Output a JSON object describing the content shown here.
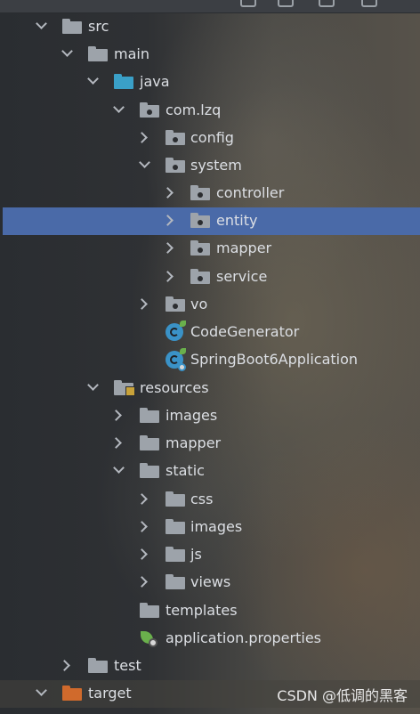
{
  "tree": {
    "items": [
      {
        "label": "src",
        "expanded": true,
        "icon": "folder-icon"
      },
      {
        "label": "main",
        "expanded": true,
        "icon": "folder-icon"
      },
      {
        "label": "java",
        "expanded": true,
        "icon": "source-folder-icon",
        "color": "#3aa0c8"
      },
      {
        "label": "com.lzq",
        "expanded": true,
        "icon": "package-icon"
      },
      {
        "label": "config",
        "expanded": false,
        "icon": "package-icon"
      },
      {
        "label": "system",
        "expanded": true,
        "icon": "package-icon"
      },
      {
        "label": "controller",
        "expanded": false,
        "icon": "package-icon"
      },
      {
        "label": "entity",
        "expanded": false,
        "icon": "package-icon",
        "selected": true
      },
      {
        "label": "mapper",
        "expanded": false,
        "icon": "package-icon"
      },
      {
        "label": "service",
        "expanded": false,
        "icon": "package-icon"
      },
      {
        "label": "vo",
        "expanded": false,
        "icon": "package-icon"
      },
      {
        "label": "CodeGenerator",
        "icon": "java-class-icon"
      },
      {
        "label": "SpringBoot6Application",
        "icon": "spring-boot-app-icon"
      },
      {
        "label": "resources",
        "expanded": true,
        "icon": "resources-folder-icon"
      },
      {
        "label": "images",
        "expanded": false,
        "icon": "folder-icon"
      },
      {
        "label": "mapper",
        "expanded": false,
        "icon": "folder-icon"
      },
      {
        "label": "static",
        "expanded": true,
        "icon": "folder-icon"
      },
      {
        "label": "css",
        "expanded": false,
        "icon": "folder-icon"
      },
      {
        "label": "images",
        "expanded": false,
        "icon": "folder-icon"
      },
      {
        "label": "js",
        "expanded": false,
        "icon": "folder-icon"
      },
      {
        "label": "views",
        "expanded": false,
        "icon": "folder-icon"
      },
      {
        "label": "templates",
        "icon": "folder-icon"
      },
      {
        "label": "application.properties",
        "icon": "spring-properties-icon"
      },
      {
        "label": "test",
        "expanded": false,
        "icon": "folder-icon"
      },
      {
        "label": "target",
        "expanded": true,
        "icon": "excluded-folder-icon",
        "color": "#d06a2c"
      }
    ]
  },
  "watermark": "CSDN @低调的黑客",
  "colors": {
    "selection": "#4a6aa8",
    "text": "#dcdfe4",
    "folder": "#9da3aa"
  }
}
